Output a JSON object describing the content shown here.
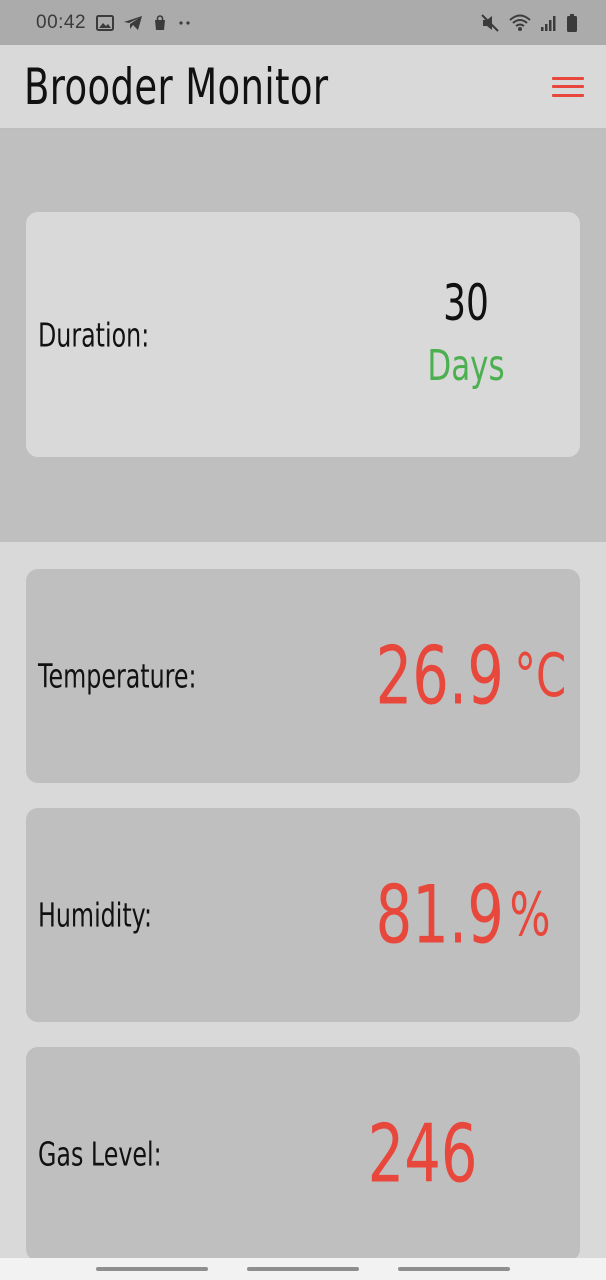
{
  "status_bar": {
    "time": "00:42",
    "left_icons": [
      "image-icon",
      "telegram-icon",
      "bag-icon",
      "more-dots-icon"
    ],
    "right_icons": [
      "mute-icon",
      "wifi-icon",
      "signal-icon",
      "battery-icon"
    ]
  },
  "app_bar": {
    "title": "Brooder Monitor",
    "menu_icon": "hamburger-menu-icon",
    "accent_color": "#e8473b"
  },
  "duration": {
    "label": "Duration:",
    "value": "30",
    "unit": "Days",
    "unit_color": "#4caf50"
  },
  "sensors": {
    "temperature": {
      "label": "Temperature:",
      "value": "26.9",
      "unit": "°C"
    },
    "humidity": {
      "label": "Humidity:",
      "value": "81.9",
      "unit": "%"
    },
    "gas": {
      "label": "Gas Level:",
      "value": "246"
    }
  },
  "colors": {
    "value_color": "#e8473b",
    "background": "#d9d9d9",
    "card_gray": "#bfbfbf"
  }
}
